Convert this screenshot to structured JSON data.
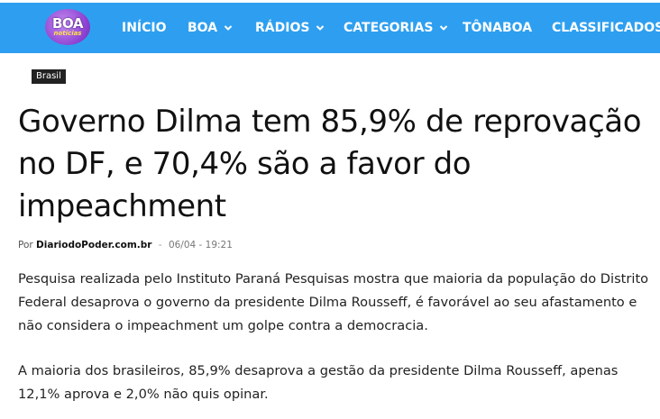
{
  "brand": {
    "logo_text": "BOA",
    "logo_subtext": "notícias",
    "nav_color": "#2e9ff0"
  },
  "nav": {
    "items": [
      {
        "label": "INÍCIO",
        "has_dropdown": false
      },
      {
        "label": "BOA",
        "has_dropdown": true
      },
      {
        "label": "RÁDIOS",
        "has_dropdown": true
      },
      {
        "label": "CATEGORIAS",
        "has_dropdown": true
      },
      {
        "label": "TÔNABOA",
        "has_dropdown": false
      },
      {
        "label": "CLASSIFICADOS",
        "has_dropdown": false
      }
    ]
  },
  "article": {
    "category": "Brasil",
    "title": "Governo Dilma tem 85,9% de reprovação no DF, e 70,4% são a favor do impeachment",
    "by_prefix": "Por",
    "author": "DiariodoPoder.com.br",
    "separator": "-",
    "date": "06/04 - 19:21",
    "paragraphs": [
      "Pesquisa realizada pelo Instituto Paraná Pesquisas mostra que maioria da população do Distrito Federal desaprova o governo da presidente Dilma Rousseff, é favorável ao seu afastamento e não considera o impeachment um golpe contra a democracia.",
      "A maioria dos brasileiros, 85,9% desaprova a gestão da presidente Dilma Rousseff, apenas 12,1% aprova e 2,0% não quis opinar."
    ]
  }
}
